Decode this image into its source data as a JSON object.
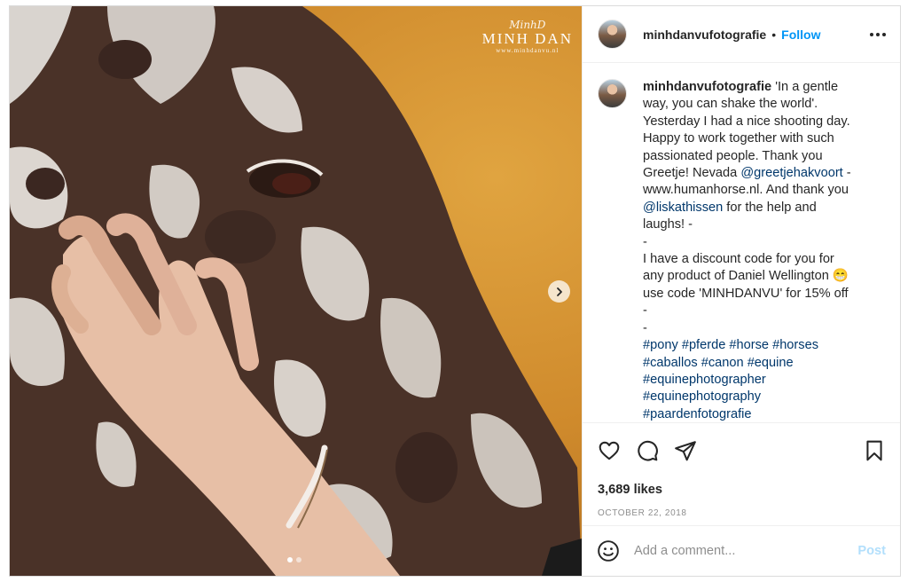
{
  "post": {
    "username": "minhdanvufotografie",
    "separator": "•",
    "follow_label": "Follow",
    "more_icon": "more-horizontal-icon",
    "watermark": {
      "signature": "MinhD",
      "name": "MINH DAN",
      "url": "www.minhdanvu.nl"
    },
    "caption": {
      "username": "minhdanvufotografie",
      "lines": [
        "'In a gentle",
        "way, you can shake the world'.",
        "Yesterday I had a nice shooting day.",
        "Happy to work together with such",
        "passionated people. Thank you",
        "Greetje! Nevada ",
        "www.humanhorse.nl. And thank you",
        " for the help and",
        "laughs! -",
        "-",
        "I have a discount code for you for",
        "any product of Daniel Wellington 😁",
        "use code 'MINHDANVU' for 15% off",
        "-",
        "-"
      ],
      "mention_1": "@greetjehakvoort",
      "after_mention_1": " -",
      "mention_2": "@liskathissen",
      "hashtags": [
        [
          "#pony",
          "#pferde",
          "#horse",
          "#horses"
        ],
        [
          "#caballos",
          "#canon",
          "#equine"
        ],
        [
          "#equinephotographer"
        ],
        [
          "#equinephotography"
        ],
        [
          "#paardenfotografie"
        ]
      ]
    },
    "likes": "3,689 likes",
    "date": "OCTOBER 22, 2018",
    "comment_placeholder": "Add a comment...",
    "post_label": "Post",
    "carousel": {
      "total": 2,
      "current": 1
    }
  },
  "colors": {
    "accent": "#0095f6",
    "link": "#00376b",
    "muted": "#8e8e8e",
    "post_disabled": "#b2dffc"
  }
}
